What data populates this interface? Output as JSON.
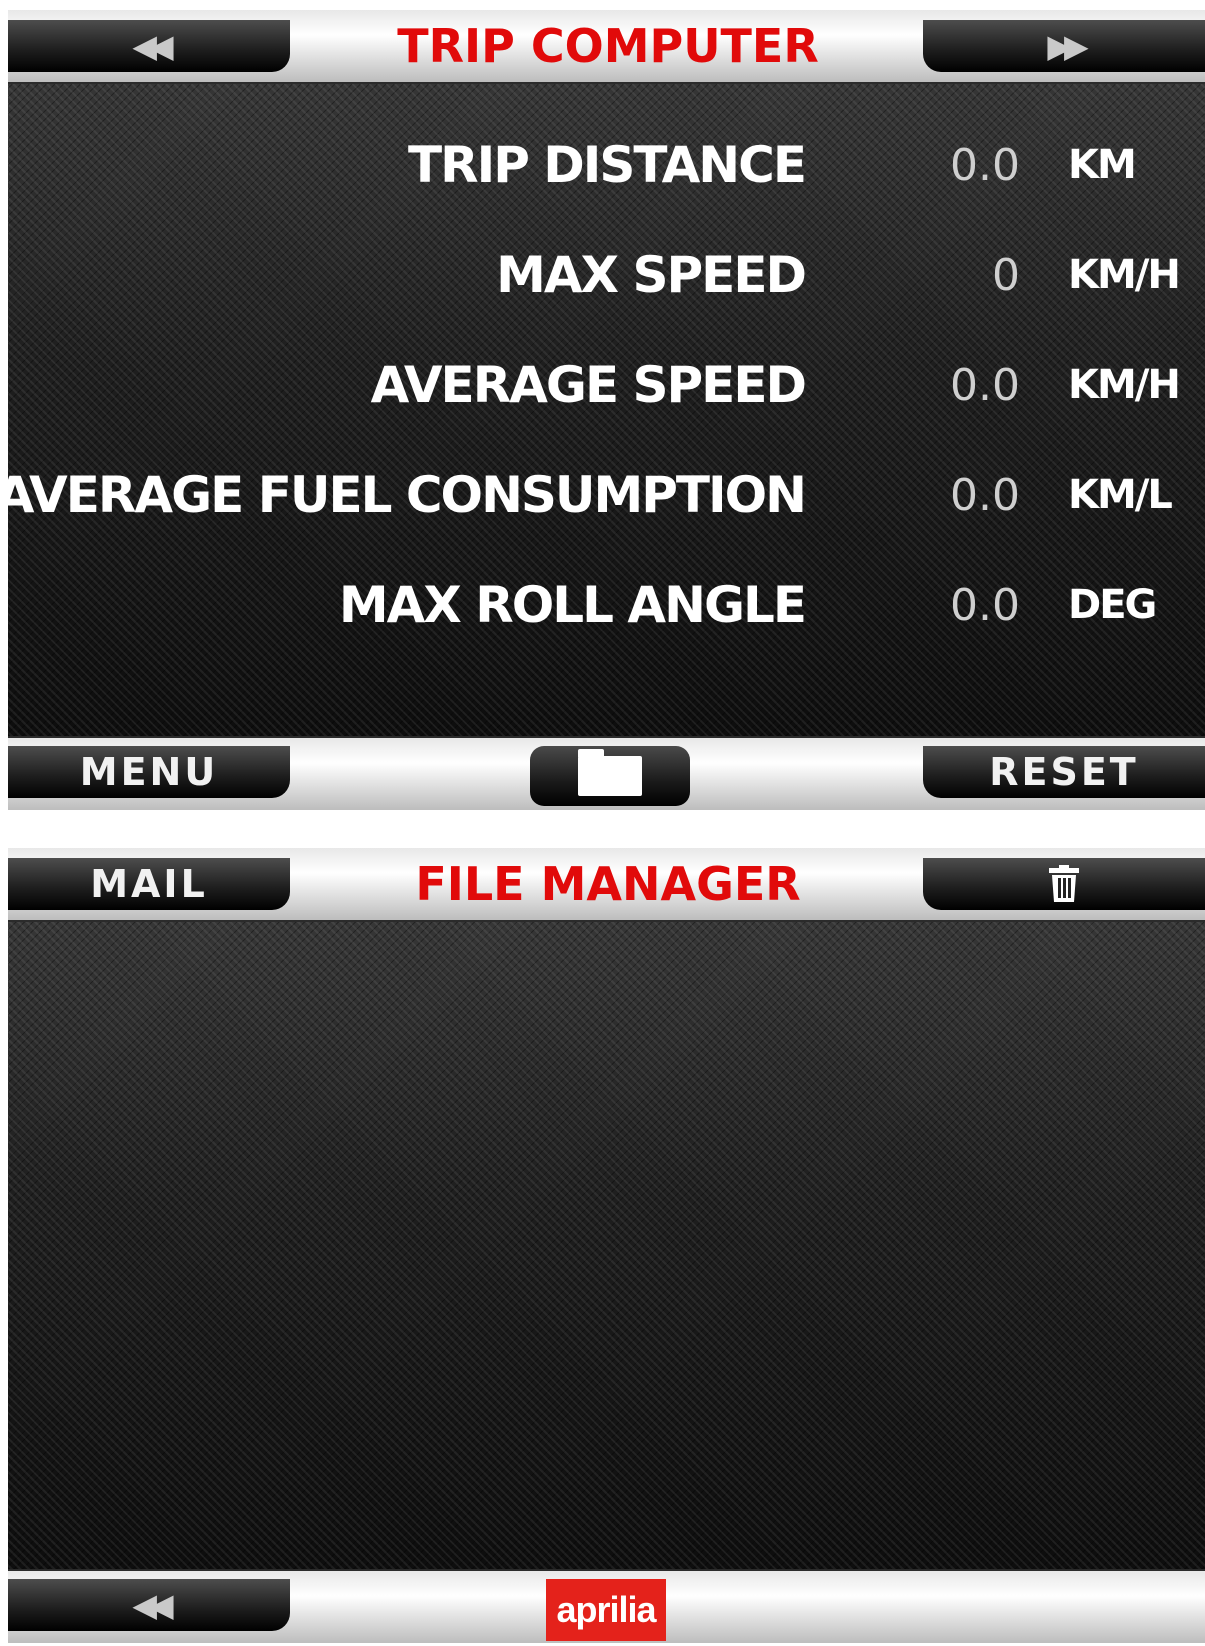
{
  "trip_screen": {
    "title": "TRIP COMPUTER",
    "top_left_icon": "rewind-icon",
    "top_right_icon": "fast-forward-icon",
    "rows": [
      {
        "label": "TRIP DISTANCE",
        "value": "0.0",
        "unit": "KM"
      },
      {
        "label": "MAX SPEED",
        "value": "0",
        "unit": "KM/H"
      },
      {
        "label": "AVERAGE SPEED",
        "value": "0.0",
        "unit": "KM/H"
      },
      {
        "label": "AVERAGE FUEL CONSUMPTION",
        "value": "0.0",
        "unit": "KM/L"
      },
      {
        "label": "MAX ROLL ANGLE",
        "value": "0.0",
        "unit": "DEG"
      }
    ],
    "bottom_left_label": "MENU",
    "bottom_center_icon": "folder-icon",
    "bottom_right_label": "RESET"
  },
  "file_screen": {
    "title": "FILE MANAGER",
    "top_left_label": "MAIL",
    "top_right_icon": "trash-icon",
    "bottom_left_icon": "rewind-icon",
    "brand_logo": "aprilia"
  },
  "colors": {
    "title_red": "#e10a0a",
    "brand_red": "#e4221b",
    "text_white": "#ffffff",
    "value_gray": "#cfcfcf"
  }
}
